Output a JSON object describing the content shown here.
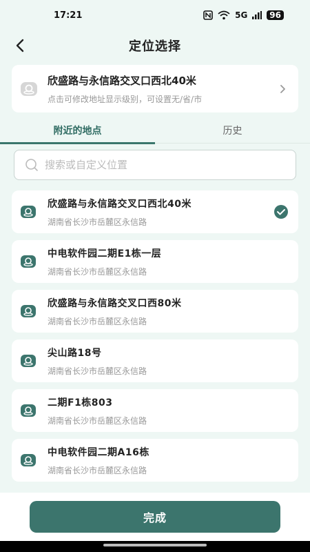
{
  "status_bar": {
    "time": "17:21",
    "network": "5G",
    "battery": "96"
  },
  "header": {
    "title": "定位选择"
  },
  "current_address": {
    "title": "欣盛路与永信路交叉口西北40米",
    "subtitle": "点击可修改地址显示级别，可设置无/省/市"
  },
  "tabs": [
    {
      "label": "附近的地点",
      "active": true
    },
    {
      "label": "历史",
      "active": false
    }
  ],
  "search": {
    "placeholder": "搜索或自定义位置",
    "value": ""
  },
  "places": [
    {
      "name": "欣盛路与永信路交叉口西北40米",
      "address": "湖南省长沙市岳麓区永信路",
      "selected": true
    },
    {
      "name": "中电软件园二期E1栋一层",
      "address": "湖南省长沙市岳麓区永信路",
      "selected": false
    },
    {
      "name": "欣盛路与永信路交叉口西80米",
      "address": "湖南省长沙市岳麓区永信路",
      "selected": false
    },
    {
      "name": "尖山路18号",
      "address": "湖南省长沙市岳麓区永信路",
      "selected": false
    },
    {
      "name": "二期F1栋803",
      "address": "湖南省长沙市岳麓区永信路",
      "selected": false
    },
    {
      "name": "中电软件园二期A16栋",
      "address": "湖南省长沙市岳麓区永信路",
      "selected": false
    }
  ],
  "footer": {
    "done_label": "完成"
  },
  "colors": {
    "accent": "#3c756d",
    "background": "#eef7f4"
  }
}
